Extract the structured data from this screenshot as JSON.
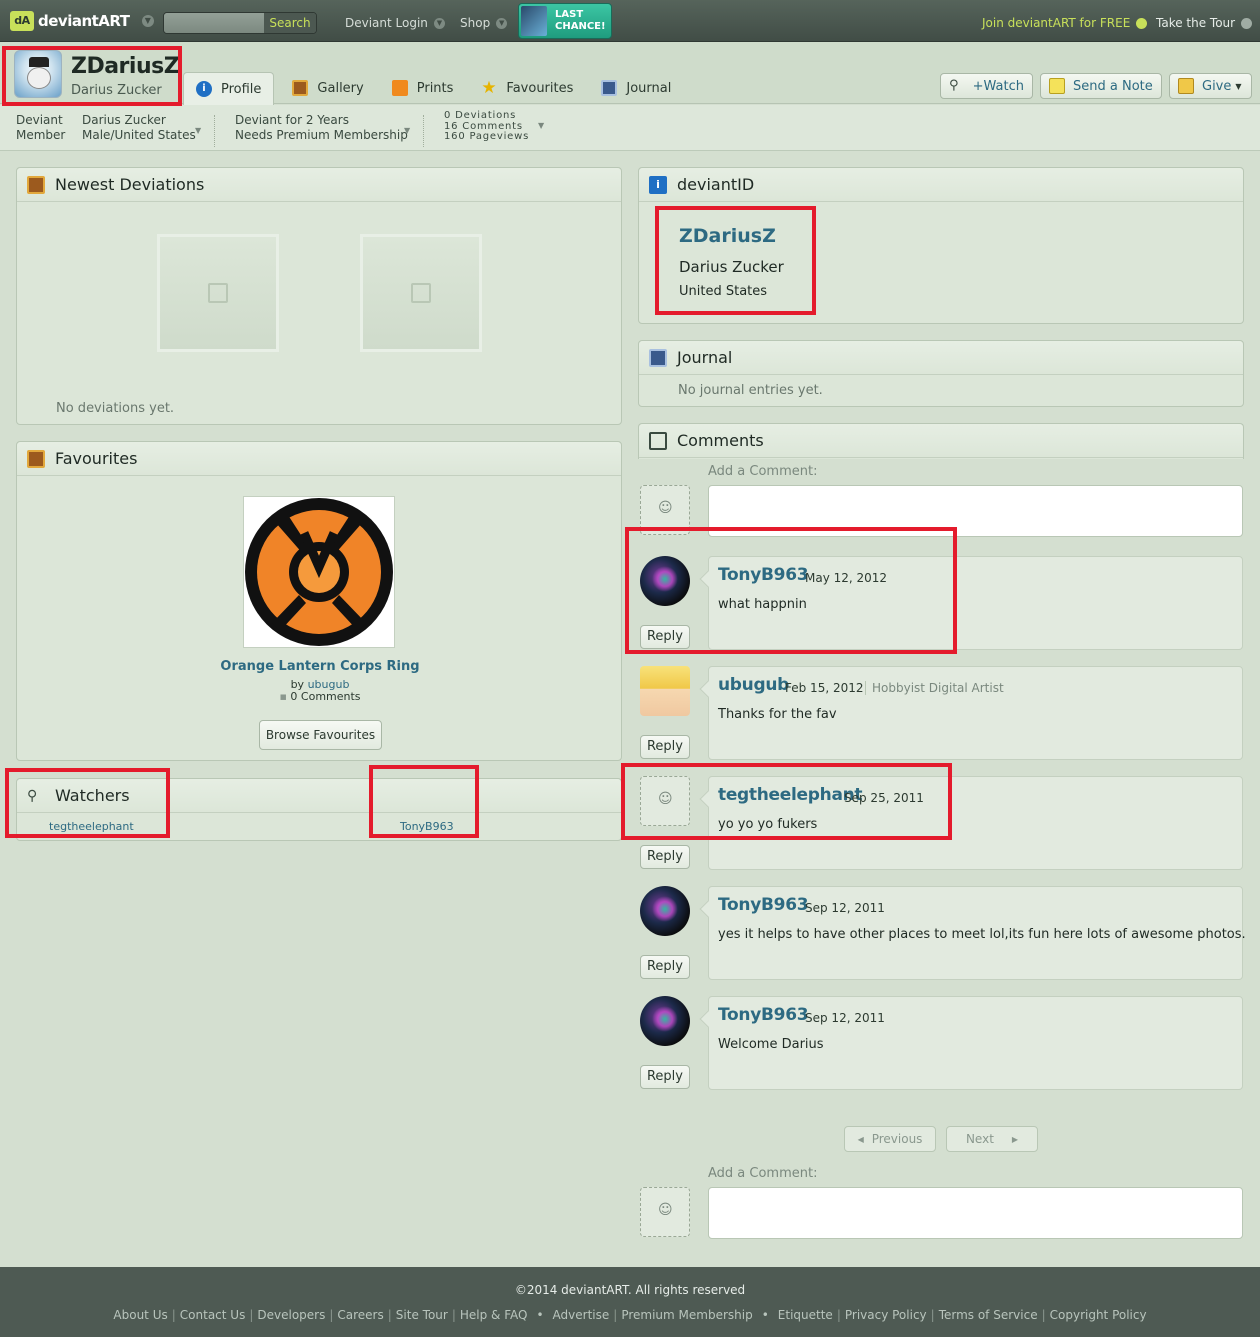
{
  "topbar": {
    "logo": "deviantART",
    "search_button": "Search",
    "login": "Deviant Login",
    "shop": "Shop",
    "promo": "LAST CHANCE!",
    "join": "Join deviantART for FREE",
    "tour": "Take the Tour"
  },
  "profile": {
    "username": "ZDariusZ",
    "realname": "Darius Zucker",
    "tabs": [
      {
        "label": "Profile",
        "icon": "info-icon"
      },
      {
        "label": "Gallery",
        "icon": "gallery-icon"
      },
      {
        "label": "Prints",
        "icon": "prints-icon"
      },
      {
        "label": "Favourites",
        "icon": "star-icon"
      },
      {
        "label": "Journal",
        "icon": "journal-icon"
      }
    ],
    "buttons": {
      "watch": "+Watch",
      "note": "Send a Note",
      "give": "Give"
    }
  },
  "infobar": {
    "member_l1": "Deviant",
    "member_l2": "Member",
    "name_l1": "Darius Zucker",
    "name_l2": "Male/United States",
    "since_l1": "Deviant for 2 Years",
    "since_l2": "Needs Premium Membership",
    "stat1": "0 Deviations",
    "stat2": "16 Comments",
    "stat3": "160 Pageviews"
  },
  "newest": {
    "title": "Newest Deviations",
    "empty": "No deviations yet."
  },
  "favourites": {
    "title": "Favourites",
    "item_title": "Orange Lantern Corps Ring",
    "by_label": "by",
    "author": "ubugub",
    "comments": "0 Comments",
    "browse": "Browse Favourites"
  },
  "watchers": {
    "title": "Watchers",
    "items": [
      "tegtheelephant",
      "TonyB963"
    ]
  },
  "deviantid": {
    "title": "deviantID",
    "username": "ZDariusZ",
    "realname": "Darius Zucker",
    "location": "United States"
  },
  "journal": {
    "title": "Journal",
    "empty": "No journal entries yet."
  },
  "comments": {
    "title": "Comments",
    "add_label": "Add a Comment:",
    "reply": "Reply",
    "items": [
      {
        "author": "TonyB963",
        "date": "May 12, 2012",
        "role": "",
        "text": "what happnin"
      },
      {
        "author": "ubugub",
        "date": "Feb 15, 2012",
        "role": "Hobbyist Digital Artist",
        "text": "Thanks for the fav"
      },
      {
        "author": "tegtheelephant",
        "date": "Sep 25, 2011",
        "role": "",
        "text": "yo yo yo fukers"
      },
      {
        "author": "TonyB963",
        "date": "Sep 12, 2011",
        "role": "",
        "text": "yes it helps to have other places to meet lol,its fun here lots of awesome photos."
      },
      {
        "author": "TonyB963",
        "date": "Sep 12, 2011",
        "role": "",
        "text": "Welcome Darius"
      }
    ],
    "previous": "Previous",
    "next": "Next"
  },
  "footer": {
    "copyright": "©2014 deviantART. All rights reserved",
    "group1": [
      "About Us",
      "Contact Us",
      "Developers",
      "Careers",
      "Site Tour",
      "Help & FAQ"
    ],
    "group2": [
      "Advertise",
      "Premium Membership"
    ],
    "group3": [
      "Etiquette",
      "Privacy Policy",
      "Terms of Service",
      "Copyright Policy"
    ]
  },
  "colors": {
    "accent": "#2d6a82",
    "highlight": "#e41b2c",
    "brand_green": "#c8e05a"
  }
}
